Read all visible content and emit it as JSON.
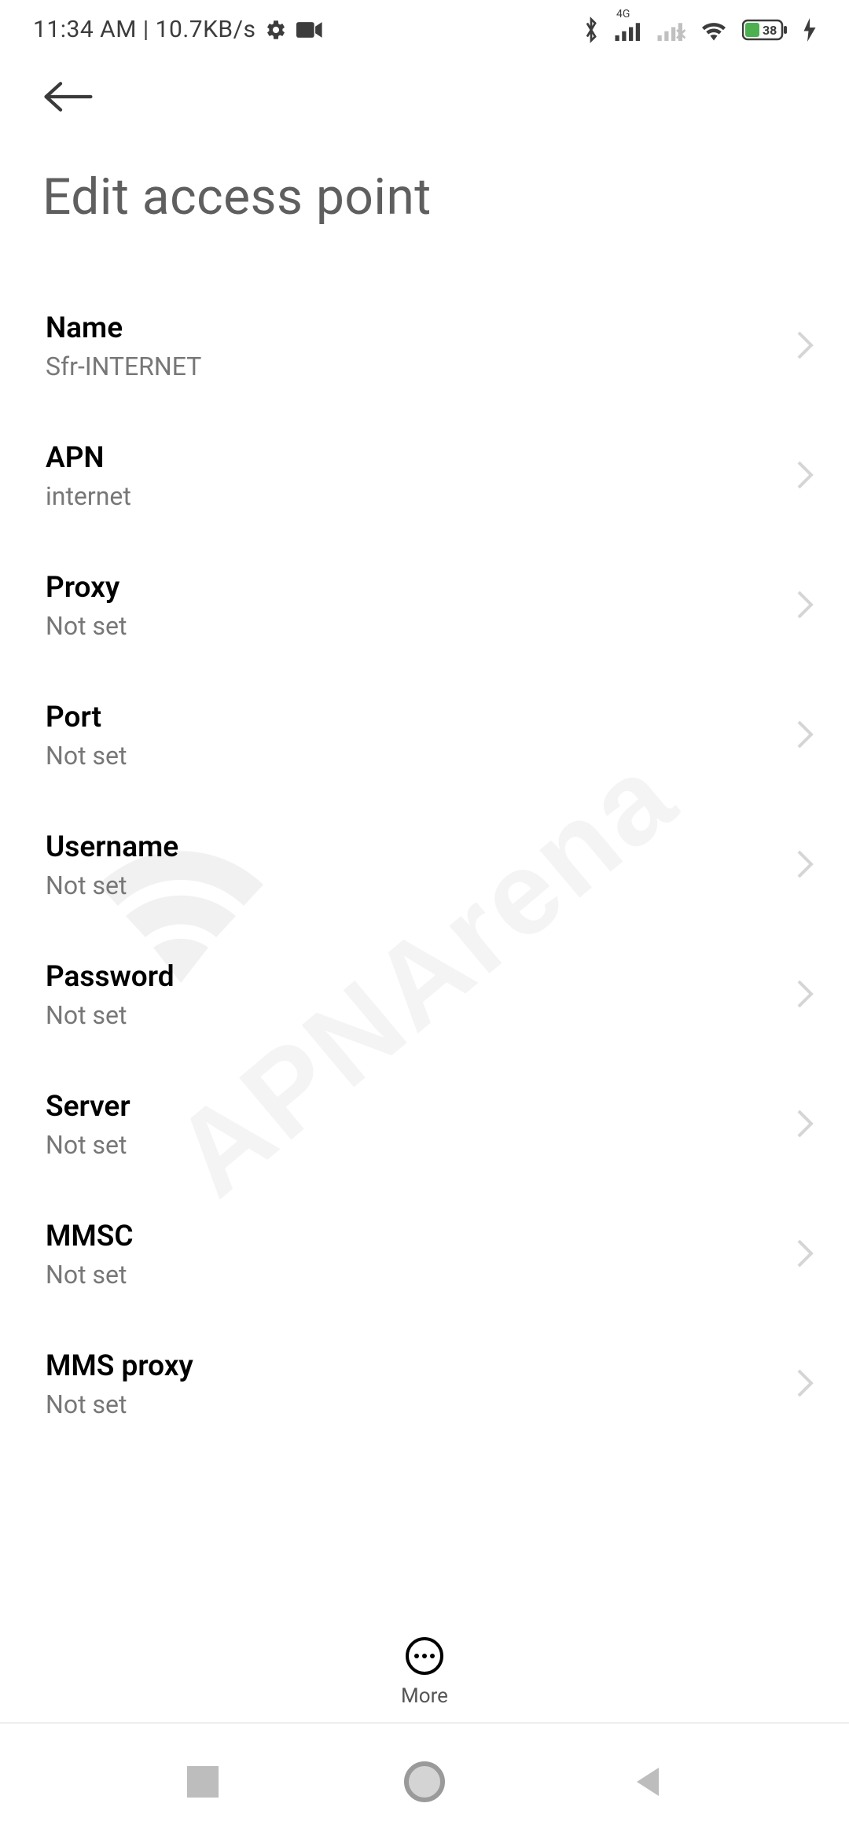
{
  "status": {
    "text": "11:34 AM | 10.7KB/s",
    "network_label": "4G",
    "battery_percent": "38"
  },
  "page_title": "Edit access point",
  "more_label": "More",
  "rows": [
    {
      "label": "Name",
      "value": "Sfr-INTERNET"
    },
    {
      "label": "APN",
      "value": "internet"
    },
    {
      "label": "Proxy",
      "value": "Not set"
    },
    {
      "label": "Port",
      "value": "Not set"
    },
    {
      "label": "Username",
      "value": "Not set"
    },
    {
      "label": "Password",
      "value": "Not set"
    },
    {
      "label": "Server",
      "value": "Not set"
    },
    {
      "label": "MMSC",
      "value": "Not set"
    },
    {
      "label": "MMS proxy",
      "value": "Not set"
    }
  ],
  "watermark": "APNArena"
}
